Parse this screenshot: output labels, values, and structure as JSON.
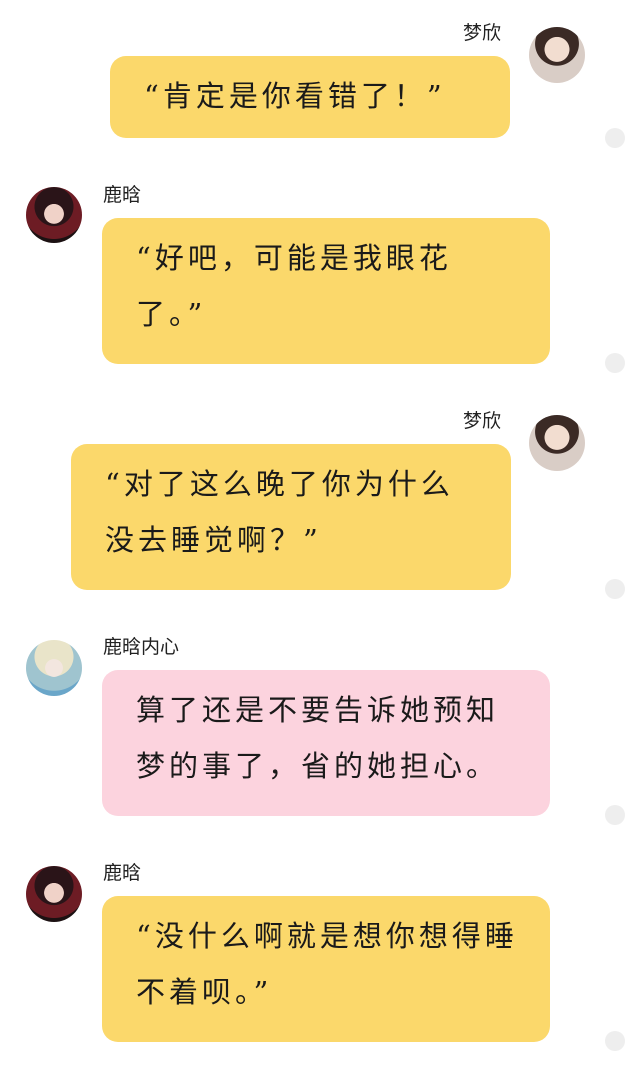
{
  "messages": [
    {
      "side": "right",
      "name": "梦欣",
      "text": "“肯定是你看错了！”",
      "color": "#fbd86b",
      "avatar": "girl-avatar"
    },
    {
      "side": "left",
      "name": "鹿晗",
      "text": "“好吧，可能是我眼花了。”",
      "color": "#fbd86b",
      "avatar": "boy-avatar"
    },
    {
      "side": "right",
      "name": "梦欣",
      "text": "“对了这么晚了你为什么没去睡觉啊？”",
      "color": "#fbd86b",
      "avatar": "girl-avatar"
    },
    {
      "side": "left",
      "name": "鹿晗内心",
      "text": "算了还是不要告诉她预知梦的事了，省的她担心。",
      "color": "#fcd3de",
      "avatar": "boy-inner-avatar"
    },
    {
      "side": "left",
      "name": "鹿晗",
      "text": "“没什么啊就是想你想得睡不着呗。”",
      "color": "#fbd86b",
      "avatar": "boy-avatar"
    }
  ]
}
